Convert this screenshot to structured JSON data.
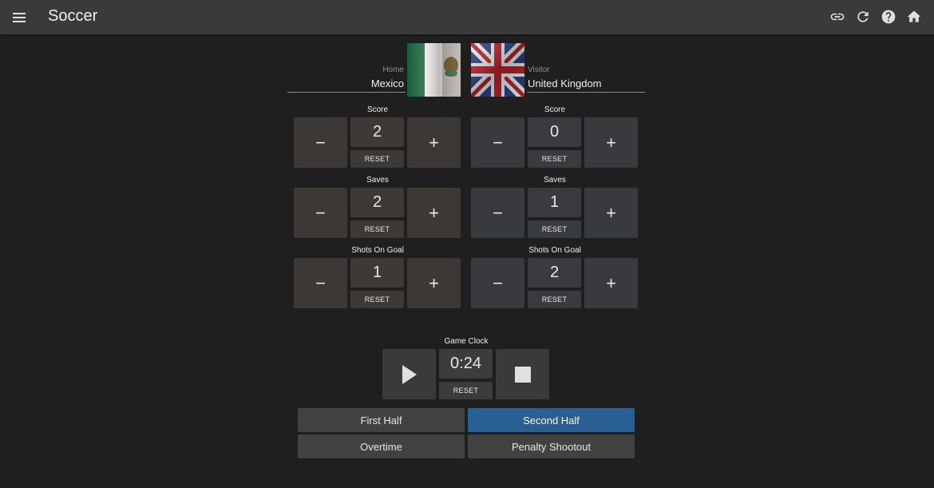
{
  "app": {
    "title": "Soccer"
  },
  "home": {
    "label": "Home",
    "name": "Mexico",
    "stats": [
      {
        "label": "Score",
        "value": "2"
      },
      {
        "label": "Saves",
        "value": "2"
      },
      {
        "label": "Shots On Goal",
        "value": "1"
      }
    ]
  },
  "visitor": {
    "label": "Visitor",
    "name": "United Kingdom",
    "stats": [
      {
        "label": "Score",
        "value": "0"
      },
      {
        "label": "Saves",
        "value": "1"
      },
      {
        "label": "Shots On Goal",
        "value": "2"
      }
    ]
  },
  "controls": {
    "minus": "−",
    "plus": "+",
    "reset": "RESET"
  },
  "clock": {
    "label": "Game Clock",
    "time": "0:24",
    "reset": "RESET"
  },
  "periods": [
    {
      "label": "First Half",
      "active": false
    },
    {
      "label": "Second Half",
      "active": true
    },
    {
      "label": "Overtime",
      "active": false
    },
    {
      "label": "Penalty Shootout",
      "active": false
    }
  ],
  "colors": {
    "active_period": "#2a5f93",
    "appbar": "#3a3a3a",
    "background": "#1f1f1f"
  }
}
